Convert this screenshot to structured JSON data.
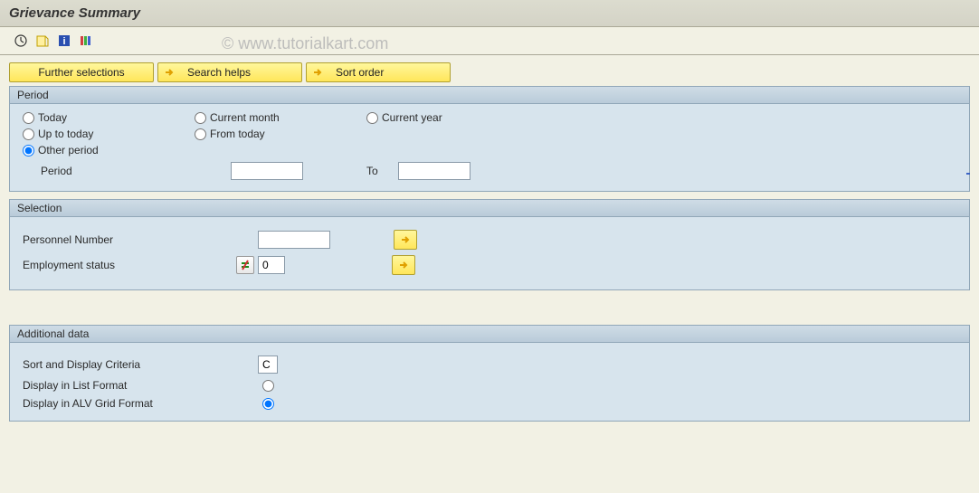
{
  "title": "Grievance Summary",
  "watermark": "© www.tutorialkart.com",
  "toolbar_buttons": {
    "further_selections": "Further selections",
    "search_helps": "Search helps",
    "sort_order": "Sort order"
  },
  "period_panel": {
    "title": "Period",
    "options": {
      "today": "Today",
      "current_month": "Current month",
      "current_year": "Current year",
      "up_to_today": "Up to today",
      "from_today": "From today",
      "other_period": "Other period"
    },
    "selected": "other_period",
    "period_label": "Period",
    "to_label": "To",
    "period_from": "",
    "period_to": ""
  },
  "selection_panel": {
    "title": "Selection",
    "personnel_number_label": "Personnel Number",
    "personnel_number_value": "",
    "employment_status_label": "Employment status",
    "employment_status_value": "0"
  },
  "additional_panel": {
    "title": "Additional data",
    "sort_display_label": "Sort and Display Criteria",
    "sort_display_value": "C",
    "list_format_label": "Display in List Format",
    "alv_format_label": "Display in ALV Grid Format",
    "display_selected": "alv"
  }
}
